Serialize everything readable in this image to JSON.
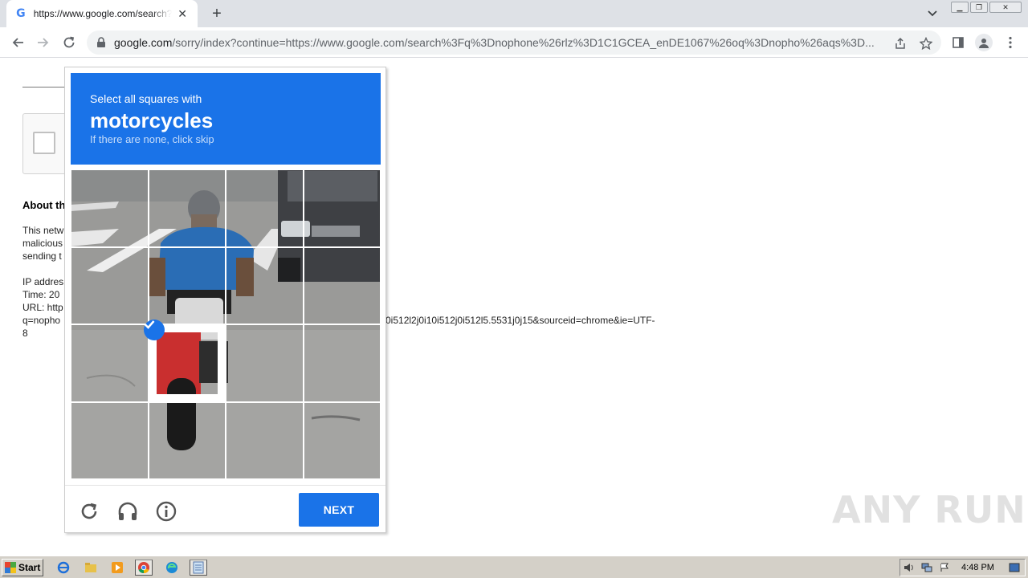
{
  "browser": {
    "tab": {
      "title": "https://www.google.com/search?q=nophone",
      "favicon": "google-g-icon"
    },
    "address": {
      "host": "google.com",
      "path": "/sorry/index?continue=https://www.google.com/search%3Fq%3Dnophone%26rlz%3D1C1GCEA_enDE1067%26oq%3Dnopho%26aqs%3D..."
    }
  },
  "page": {
    "about_heading": "About th",
    "para_lines": [
      "This netw",
      "malicious",
      "sending t"
    ],
    "info_lines": [
      "IP addres",
      "Time: 20",
      "URL: http",
      "q=nopho",
      "8"
    ],
    "url_tail": "0i512l2j0i10i512j0i512l5.5531j0j15&sourceid=chrome&ie=UTF-"
  },
  "captcha": {
    "line1": "Select all squares with",
    "keyword": "motorcycles",
    "line3": "If there are none, click skip",
    "next_label": "NEXT",
    "selected_tiles": [
      "r2c1"
    ],
    "icons": [
      "reload-icon",
      "audio-icon",
      "info-icon"
    ]
  },
  "watermark": "ANY RUN",
  "taskbar": {
    "start_label": "Start",
    "clock": "4:48 PM"
  },
  "colors": {
    "captcha_blue": "#1a73e8",
    "tab_strip": "#dee1e6",
    "taskbar": "#d4d0c8"
  }
}
